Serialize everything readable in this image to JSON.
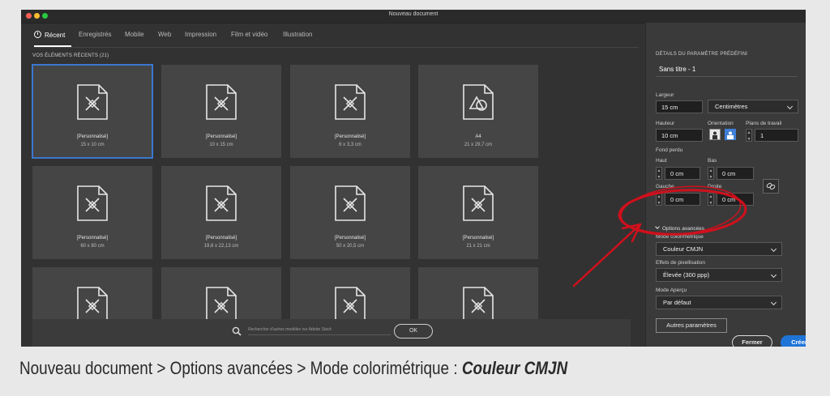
{
  "window": {
    "title": "Nouveau document"
  },
  "tabs": [
    {
      "label": "Récent"
    },
    {
      "label": "Enregistrés"
    },
    {
      "label": "Mobile"
    },
    {
      "label": "Web"
    },
    {
      "label": "Impression"
    },
    {
      "label": "Film et vidéo"
    },
    {
      "label": "Illustration"
    }
  ],
  "recent": {
    "header": "VOS ÉLÉMENTS RÉCENTS  (21)",
    "tiles": [
      {
        "title": "[Personnalisé]",
        "dims": "15 x 10 cm",
        "icon": "document-pencil-icon"
      },
      {
        "title": "[Personnalisé]",
        "dims": "10 x 15 cm",
        "icon": "document-pencil-icon"
      },
      {
        "title": "[Personnalisé]",
        "dims": "6 x 3,3 cm",
        "icon": "document-pencil-icon"
      },
      {
        "title": "A4",
        "dims": "21 x 29,7 cm",
        "icon": "document-shapes-icon"
      },
      {
        "title": "[Personnalisé]",
        "dims": "60 x 80 cm",
        "icon": "document-pencil-icon"
      },
      {
        "title": "[Personnalisé]",
        "dims": "19,6 x 22,13 cm",
        "icon": "document-pencil-icon"
      },
      {
        "title": "[Personnalisé]",
        "dims": "50 x 20,5 cm",
        "icon": "document-pencil-icon"
      },
      {
        "title": "[Personnalisé]",
        "dims": "21 x 21 cm",
        "icon": "document-pencil-icon"
      },
      {
        "title": "",
        "dims": "",
        "icon": "document-pencil-icon"
      },
      {
        "title": "",
        "dims": "",
        "icon": "document-pencil-icon"
      },
      {
        "title": "",
        "dims": "",
        "icon": "document-pencil-icon"
      },
      {
        "title": "",
        "dims": "",
        "icon": "document-pencil-icon"
      }
    ]
  },
  "search": {
    "placeholder": "Rechercher d'autres modèles sur Adobe Stock",
    "ok_label": "OK"
  },
  "details": {
    "heading": "DÉTAILS DU PARAMÈTRE PRÉDÉFINI",
    "name": "Sans titre - 1",
    "width_label": "Largeur",
    "width_value": "15 cm",
    "units_value": "Centimètres",
    "height_label": "Hauteur",
    "height_value": "10 cm",
    "orientation_label": "Orientation",
    "artboards_label": "Plans de travail",
    "artboards_value": "1",
    "bleed_label": "Fond perdu",
    "top_label": "Haut",
    "top_value": "0 cm",
    "bottom_label": "Bas",
    "bottom_value": "0 cm",
    "left_label": "Gauche",
    "left_value": "0 cm",
    "right_label": "Droite",
    "right_value": "0 cm",
    "advanced_label": "Options avancées",
    "color_mode_label": "Mode colorimétrique",
    "color_mode_value": "Couleur CMJN",
    "raster_label": "Effets de pixellisation",
    "raster_value": "Élevée (300 ppp)",
    "preview_label": "Mode Aperçu",
    "preview_value": "Par défaut",
    "more_settings_label": "Autres paramètres",
    "close_label": "Fermer",
    "create_label": "Créer"
  },
  "caption": {
    "prefix": "Nouveau document > Options avancées > Mode colorimétrique : ",
    "emphasis": "Couleur CMJN"
  },
  "colors": {
    "accent": "#1f74d8",
    "annotation": "#d0101c",
    "window_bg": "#323232",
    "tile_bg": "#454545"
  }
}
